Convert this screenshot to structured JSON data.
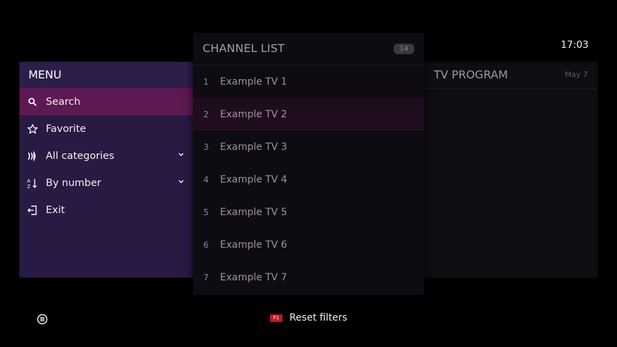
{
  "clock": "17:03",
  "menu": {
    "title": "MENU",
    "items": [
      {
        "label": "Search",
        "icon": "search-icon",
        "active": true,
        "chevron": false
      },
      {
        "label": "Favorite",
        "icon": "star-icon",
        "active": false,
        "chevron": false
      },
      {
        "label": "All categories",
        "icon": "categories-icon",
        "active": false,
        "chevron": true
      },
      {
        "label": "By number",
        "icon": "sort-az-icon",
        "active": false,
        "chevron": true
      },
      {
        "label": "Exit",
        "icon": "exit-icon",
        "active": false,
        "chevron": false
      }
    ]
  },
  "channels": {
    "title": "CHANNEL LIST",
    "count": "14",
    "items": [
      {
        "number": "1",
        "name": "Example TV 1"
      },
      {
        "number": "2",
        "name": "Example TV 2"
      },
      {
        "number": "3",
        "name": "Example TV 3"
      },
      {
        "number": "4",
        "name": "Example TV 4"
      },
      {
        "number": "5",
        "name": "Example TV 5"
      },
      {
        "number": "6",
        "name": "Example TV 6"
      },
      {
        "number": "7",
        "name": "Example TV 7"
      }
    ],
    "focused_index": 1
  },
  "program": {
    "title": "TV PROGRAM",
    "date": "May 7"
  },
  "footer": {
    "key_label": "F1",
    "reset_label": "Reset filters"
  },
  "colors": {
    "menu_bg": "#281a42",
    "active_item": "#5d1a52",
    "channel_focus": "#200c1f",
    "f1_key": "#c4161c"
  }
}
